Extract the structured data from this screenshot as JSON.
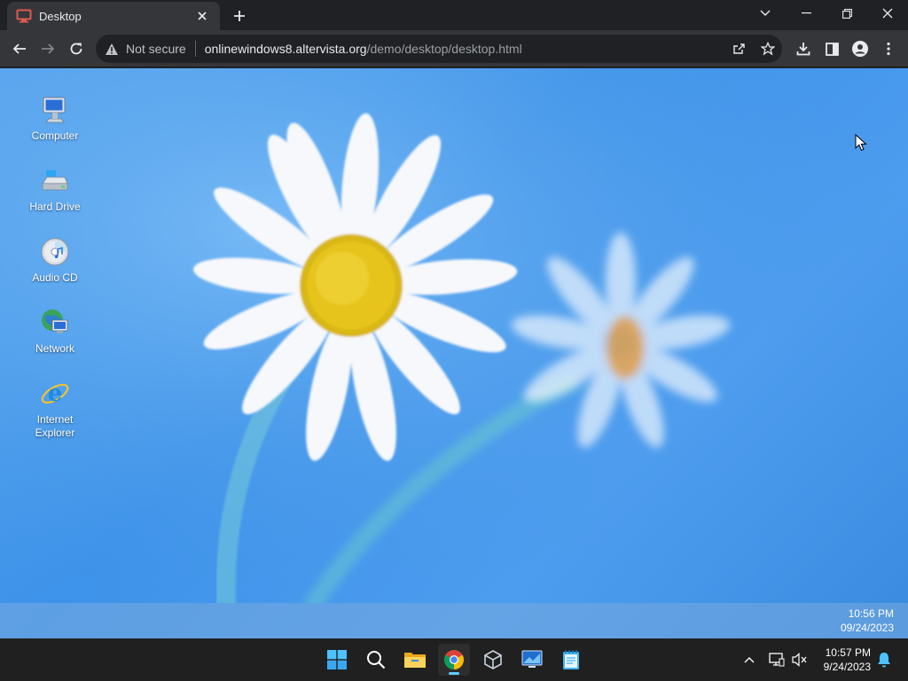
{
  "browser": {
    "tab": {
      "title": "Desktop"
    },
    "address": {
      "security_label": "Not secure",
      "host": "onlinewindows8.altervista.org",
      "path": "/demo/desktop/desktop.html"
    }
  },
  "desktop": {
    "icons": [
      {
        "label": "Computer",
        "icon": "computer-icon"
      },
      {
        "label": "Hard Drive",
        "icon": "hard-drive-icon"
      },
      {
        "label": "Audio CD",
        "icon": "audio-cd-icon"
      },
      {
        "label": "Network",
        "icon": "network-icon"
      },
      {
        "label": "Internet Explorer",
        "icon": "internet-explorer-icon"
      }
    ],
    "clock": {
      "time": "10:56 PM",
      "date": "09/24/2023"
    }
  },
  "taskbar": {
    "clock": {
      "time": "10:57 PM",
      "date": "9/24/2023"
    }
  },
  "colors": {
    "chrome_dark": "#202124",
    "chrome_toolbar": "#35363a",
    "desktop_blue": "#4d9df0",
    "taskbar": "#202020",
    "accent": "#60cdff"
  }
}
